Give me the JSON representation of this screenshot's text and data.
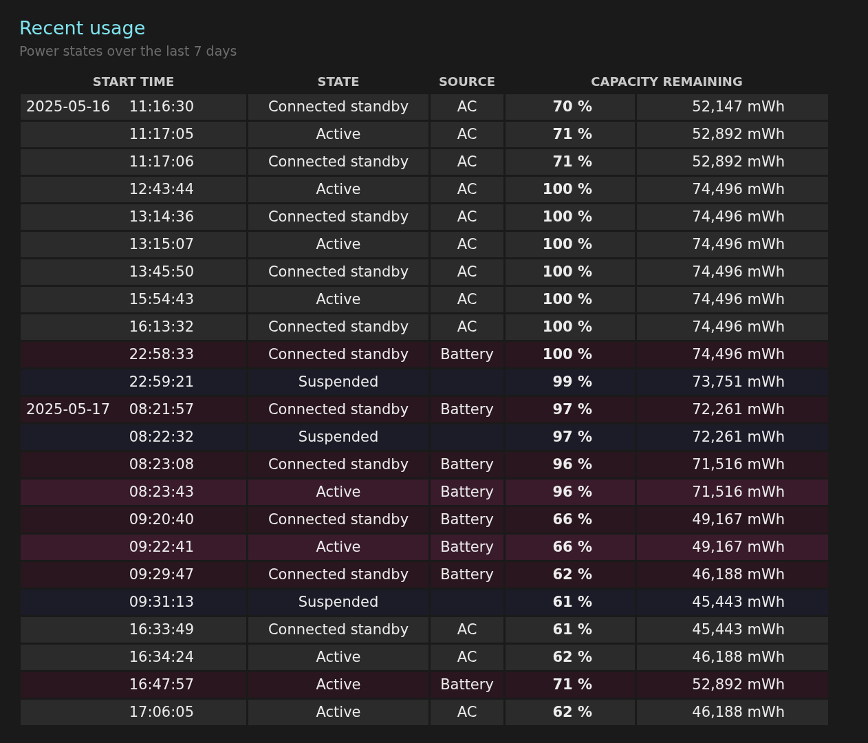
{
  "section": {
    "title": "Recent usage",
    "subtitle": "Power states over the last 7 days"
  },
  "table": {
    "columns": [
      "START TIME",
      "STATE",
      "SOURCE",
      "CAPACITY REMAINING"
    ],
    "rows": [
      {
        "kind": "ac",
        "date": "2025-05-16",
        "time": "11:16:30",
        "state": "Connected standby",
        "source": "AC",
        "percent": "70 %",
        "energy": "52,147 mWh"
      },
      {
        "kind": "ac",
        "time": "11:17:05",
        "state": "Active",
        "source": "AC",
        "percent": "71 %",
        "energy": "52,892 mWh"
      },
      {
        "kind": "ac",
        "time": "11:17:06",
        "state": "Connected standby",
        "source": "AC",
        "percent": "71 %",
        "energy": "52,892 mWh"
      },
      {
        "kind": "ac",
        "time": "12:43:44",
        "state": "Active",
        "source": "AC",
        "percent": "100 %",
        "energy": "74,496 mWh"
      },
      {
        "kind": "ac",
        "time": "13:14:36",
        "state": "Connected standby",
        "source": "AC",
        "percent": "100 %",
        "energy": "74,496 mWh"
      },
      {
        "kind": "ac",
        "time": "13:15:07",
        "state": "Active",
        "source": "AC",
        "percent": "100 %",
        "energy": "74,496 mWh"
      },
      {
        "kind": "ac",
        "time": "13:45:50",
        "state": "Connected standby",
        "source": "AC",
        "percent": "100 %",
        "energy": "74,496 mWh"
      },
      {
        "kind": "ac",
        "time": "15:54:43",
        "state": "Active",
        "source": "AC",
        "percent": "100 %",
        "energy": "74,496 mWh"
      },
      {
        "kind": "ac",
        "time": "16:13:32",
        "state": "Connected standby",
        "source": "AC",
        "percent": "100 %",
        "energy": "74,496 mWh"
      },
      {
        "kind": "battery",
        "time": "22:58:33",
        "state": "Connected standby",
        "source": "Battery",
        "percent": "100 %",
        "energy": "74,496 mWh"
      },
      {
        "kind": "suspended",
        "time": "22:59:21",
        "state": "Suspended",
        "percent": "99 %",
        "energy": "73,751 mWh"
      },
      {
        "kind": "battery",
        "date": "2025-05-17",
        "time": "08:21:57",
        "state": "Connected standby",
        "source": "Battery",
        "percent": "97 %",
        "energy": "72,261 mWh"
      },
      {
        "kind": "suspended",
        "time": "08:22:32",
        "state": "Suspended",
        "percent": "97 %",
        "energy": "72,261 mWh"
      },
      {
        "kind": "battery",
        "time": "08:23:08",
        "state": "Connected standby",
        "source": "Battery",
        "percent": "96 %",
        "energy": "71,516 mWh"
      },
      {
        "kind": "battery-active",
        "time": "08:23:43",
        "state": "Active",
        "source": "Battery",
        "percent": "96 %",
        "energy": "71,516 mWh"
      },
      {
        "kind": "battery",
        "time": "09:20:40",
        "state": "Connected standby",
        "source": "Battery",
        "percent": "66 %",
        "energy": "49,167 mWh"
      },
      {
        "kind": "battery-active",
        "time": "09:22:41",
        "state": "Active",
        "source": "Battery",
        "percent": "66 %",
        "energy": "49,167 mWh"
      },
      {
        "kind": "battery",
        "time": "09:29:47",
        "state": "Connected standby",
        "source": "Battery",
        "percent": "62 %",
        "energy": "46,188 mWh"
      },
      {
        "kind": "suspended",
        "time": "09:31:13",
        "state": "Suspended",
        "percent": "61 %",
        "energy": "45,443 mWh"
      },
      {
        "kind": "ac",
        "time": "16:33:49",
        "state": "Connected standby",
        "source": "AC",
        "percent": "61 %",
        "energy": "45,443 mWh"
      },
      {
        "kind": "ac",
        "time": "16:34:24",
        "state": "Active",
        "source": "AC",
        "percent": "62 %",
        "energy": "46,188 mWh"
      },
      {
        "kind": "battery",
        "time": "16:47:57",
        "state": "Active",
        "source": "Battery",
        "percent": "71 %",
        "energy": "52,892 mWh"
      },
      {
        "kind": "ac",
        "time": "17:06:05",
        "state": "Active",
        "source": "AC",
        "percent": "62 %",
        "energy": "46,188 mWh"
      }
    ]
  }
}
